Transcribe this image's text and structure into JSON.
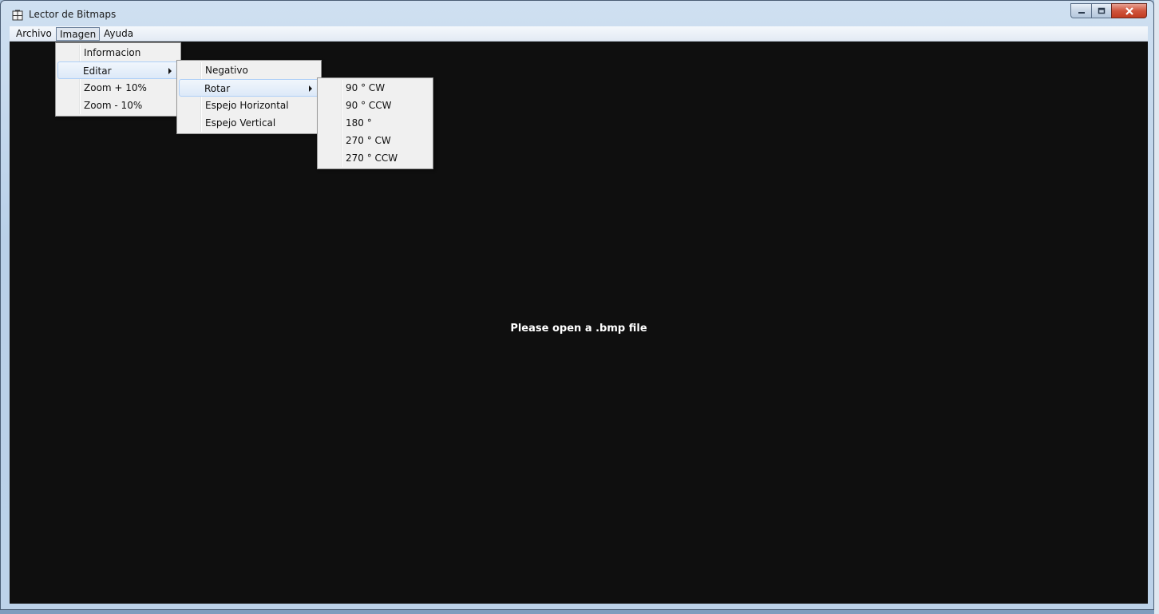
{
  "window": {
    "title": "Lector de Bitmaps"
  },
  "menubar": {
    "items": [
      {
        "label": "Archivo"
      },
      {
        "label": "Imagen"
      },
      {
        "label": "Ayuda"
      }
    ]
  },
  "imagen_menu": {
    "items": [
      {
        "label": "Informacion"
      },
      {
        "label": "Editar"
      },
      {
        "label": "Zoom + 10%"
      },
      {
        "label": "Zoom - 10%"
      }
    ]
  },
  "editar_menu": {
    "items": [
      {
        "label": "Negativo"
      },
      {
        "label": "Rotar"
      },
      {
        "label": "Espejo Horizontal"
      },
      {
        "label": "Espejo Vertical"
      }
    ]
  },
  "rotar_menu": {
    "items": [
      {
        "label": "90 ° CW"
      },
      {
        "label": "90 ° CCW"
      },
      {
        "label": "180 °"
      },
      {
        "label": "270 ° CW"
      },
      {
        "label": "270 ° CCW"
      }
    ]
  },
  "content": {
    "message": "Please open a .bmp file"
  },
  "colors": {
    "canvas_background": "#0f0f0f",
    "highlight_border": "#aecff7",
    "close_button": "#c13b20"
  }
}
